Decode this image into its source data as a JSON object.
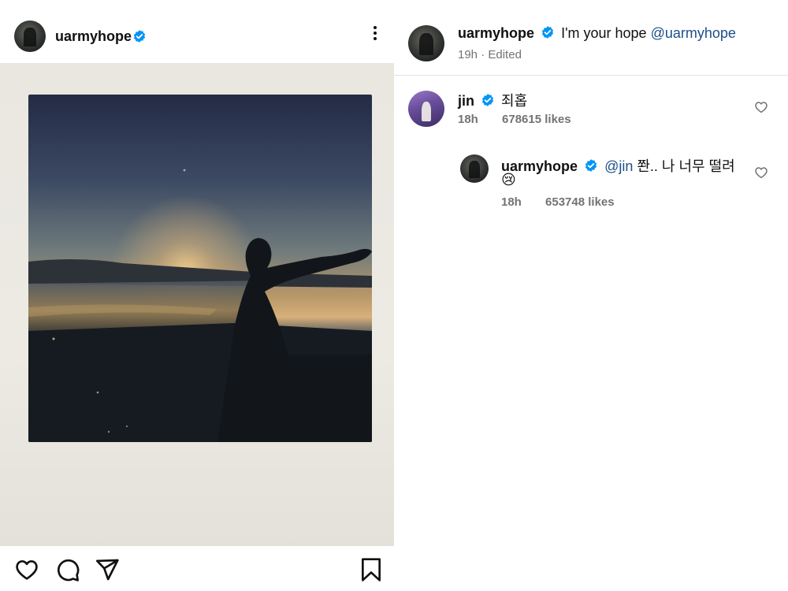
{
  "post": {
    "author": "uarmyhope",
    "menu_icon": "more-vertical-icon",
    "actions": [
      "heart-icon",
      "comment-icon",
      "share-icon",
      "bookmark-icon"
    ]
  },
  "caption": {
    "author": "uarmyhope",
    "text": "I'm your hope",
    "mention": "@uarmyhope",
    "time": "19h",
    "edited": "Edited"
  },
  "comments": [
    {
      "author": "jin",
      "text": "죄홉",
      "time": "18h",
      "likes": "678615 likes",
      "mention": ""
    },
    {
      "author": "uarmyhope",
      "mention": "@jin",
      "text": "쫜.. 나 너무 떨려",
      "emoji": "😢",
      "time": "18h",
      "likes": "653748 likes"
    }
  ],
  "colors": {
    "verified": "#0095f6",
    "mention": "#1d4e89",
    "meta": "#737373"
  }
}
